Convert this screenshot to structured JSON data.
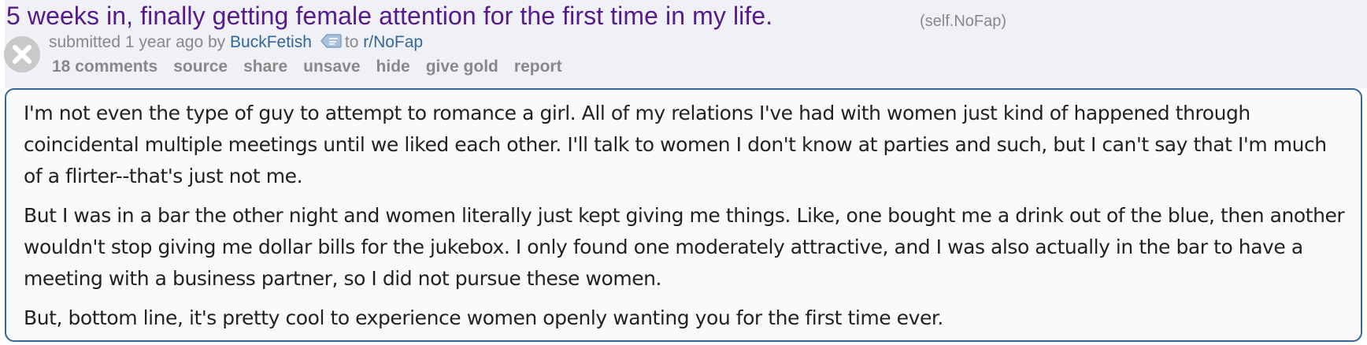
{
  "post": {
    "title": "5 weeks in, finally getting female attention for the first time in my life.",
    "domain": "self.NoFap",
    "tagline": {
      "submitted": "submitted",
      "time": "1 year ago",
      "by": "by",
      "author": "BuckFetish",
      "to": "to",
      "subreddit": "r/NoFap"
    },
    "buttons": {
      "comments": "18 comments",
      "source": "source",
      "share": "share",
      "unsave": "unsave",
      "hide": "hide",
      "give_gold": "give gold",
      "report": "report"
    },
    "body": [
      "I'm not even the type of guy to attempt to romance a girl. All of my relations I've had with women just kind of happened through coincidental multiple meetings until we liked each other. I'll talk to women I don't know at parties and such, but I can't say that I'm much of a flirter--that's just not me.",
      "But I was in a bar the other night and women literally just kept giving me things. Like, one bought me a drink out of the blue, then another wouldn't stop giving me dollar bills for the jukebox. I only found one moderately attractive, and I was also actually in the bar to have a meeting with a business partner, so I did not pursue these women.",
      "But, bottom line, it's pretty cool to experience women openly wanting you for the first time ever."
    ]
  },
  "colors": {
    "title_visited": "#551a8b",
    "link": "#336699",
    "meta_gray": "#888888",
    "header_bg": "#eff1f6",
    "body_border": "#336699"
  },
  "icons": {
    "close": "close-icon",
    "message": "message-icon"
  }
}
